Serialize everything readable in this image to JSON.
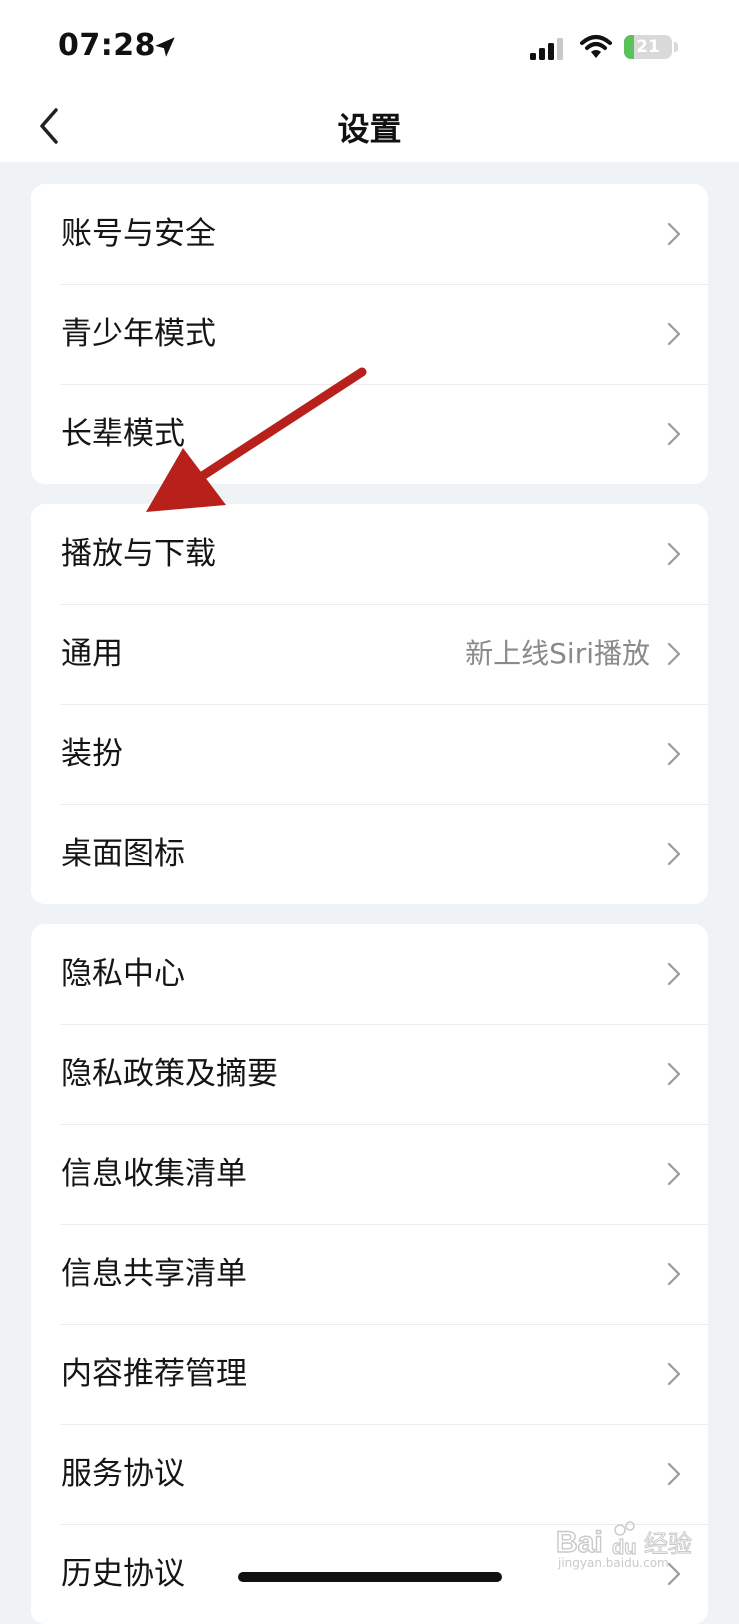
{
  "status_bar": {
    "time": "07:28",
    "battery_level": "21",
    "battery_fraction": 0.21,
    "location_icon": "location-arrow-icon",
    "signal_icon": "cellular-signal-icon",
    "wifi_icon": "wifi-icon"
  },
  "nav": {
    "title": "设置",
    "back_icon": "chevron-left-icon"
  },
  "groups": [
    {
      "items": [
        {
          "label": "账号与安全",
          "value": ""
        },
        {
          "label": "青少年模式",
          "value": ""
        },
        {
          "label": "长辈模式",
          "value": ""
        }
      ]
    },
    {
      "items": [
        {
          "label": "播放与下载",
          "value": ""
        },
        {
          "label": "通用",
          "value": "新上线Siri播放"
        },
        {
          "label": "装扮",
          "value": ""
        },
        {
          "label": "桌面图标",
          "value": ""
        }
      ]
    },
    {
      "items": [
        {
          "label": "隐私中心",
          "value": ""
        },
        {
          "label": "隐私政策及摘要",
          "value": ""
        },
        {
          "label": "信息收集清单",
          "value": ""
        },
        {
          "label": "信息共享清单",
          "value": ""
        },
        {
          "label": "内容推荐管理",
          "value": ""
        },
        {
          "label": "服务协议",
          "value": ""
        },
        {
          "label": "历史协议",
          "value": ""
        }
      ]
    }
  ],
  "annotation": {
    "type": "arrow",
    "color": "#b8201c",
    "points_to": "播放与下载"
  },
  "watermark": {
    "logo": "Bai 经验",
    "text": "jingyan.baidu.com"
  },
  "colors": {
    "background": "#f0f3f6",
    "card": "#ffffff",
    "secondary_text": "#8a8a8a",
    "battery_green": "#5bc25b"
  }
}
